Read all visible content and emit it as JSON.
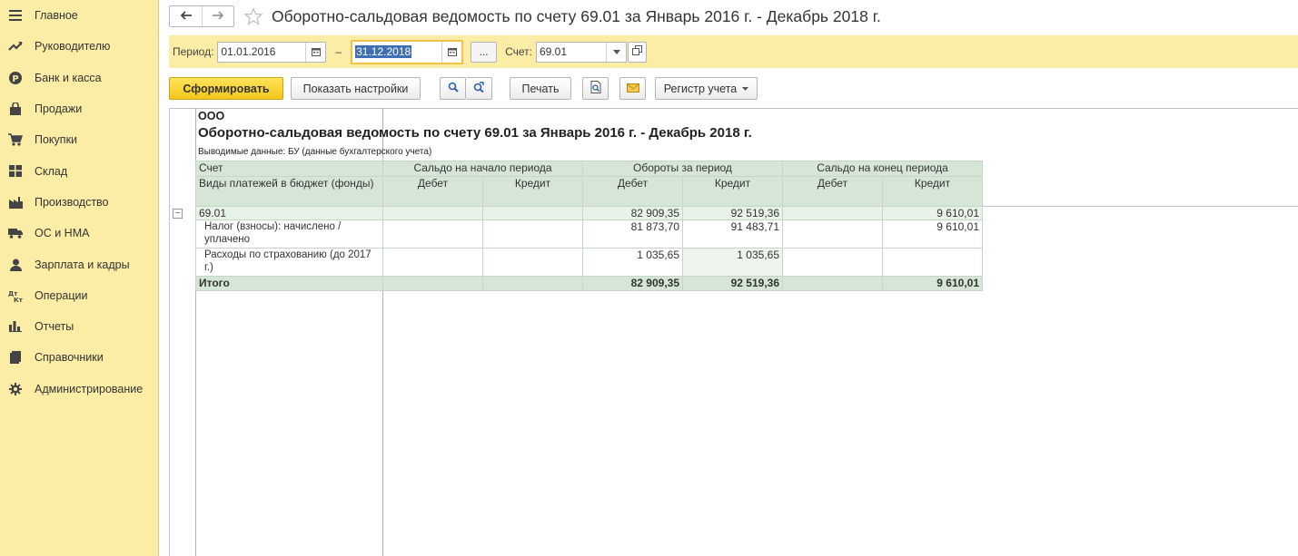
{
  "sidebar": {
    "items": [
      {
        "label": "Главное",
        "icon": "menu-icon"
      },
      {
        "label": "Руководителю",
        "icon": "trend-icon"
      },
      {
        "label": "Банк и касса",
        "icon": "ruble-icon"
      },
      {
        "label": "Продажи",
        "icon": "bag-icon"
      },
      {
        "label": "Покупки",
        "icon": "cart-icon"
      },
      {
        "label": "Склад",
        "icon": "warehouse-icon"
      },
      {
        "label": "Производство",
        "icon": "factory-icon"
      },
      {
        "label": "ОС и НМА",
        "icon": "truck-icon"
      },
      {
        "label": "Зарплата и кадры",
        "icon": "person-icon"
      },
      {
        "label": "Операции",
        "icon": "dt-kt-icon"
      },
      {
        "label": "Отчеты",
        "icon": "bar-chart-icon"
      },
      {
        "label": "Справочники",
        "icon": "book-icon"
      },
      {
        "label": "Администрирование",
        "icon": "gear-icon"
      }
    ]
  },
  "header": {
    "title": "Оборотно-сальдовая ведомость по счету 69.01 за Январь 2016 г. - Декабрь 2018 г."
  },
  "params": {
    "period_label": "Период:",
    "date_from": "01.01.2016",
    "dash": "–",
    "date_to": "31.12.2018",
    "dots": "...",
    "account_label": "Счет:",
    "account": "69.01"
  },
  "toolbar": {
    "generate": "Сформировать",
    "show_settings": "Показать настройки",
    "print": "Печать",
    "registry": "Регистр учета"
  },
  "report": {
    "org": "ООО",
    "title": "Оборотно-сальдовая ведомость по счету 69.01 за Январь 2016 г. - Декабрь 2018 г.",
    "output_data": "Выводимые данные:  БУ (данные бухгалтерского учета)",
    "headers": {
      "account": "Счет",
      "subconto": "Виды платежей в бюджет (фонды)",
      "opening": "Сальдо на начало периода",
      "turnover": "Обороты за период",
      "closing": "Сальдо на конец периода",
      "debit": "Дебет",
      "credit": "Кредит"
    },
    "rows": [
      {
        "name": "69.01",
        "open_dt": "",
        "open_kt": "",
        "turn_dt": "82 909,35",
        "turn_kt": "92 519,36",
        "close_dt": "",
        "close_kt": "9 610,01"
      },
      {
        "name": "Налог (взносы): начислено / уплачено",
        "open_dt": "",
        "open_kt": "",
        "turn_dt": "81 873,70",
        "turn_kt": "91 483,71",
        "close_dt": "",
        "close_kt": "9 610,01"
      },
      {
        "name": "Расходы по страхованию (до 2017 г.)",
        "open_dt": "",
        "open_kt": "",
        "turn_dt": "1 035,65",
        "turn_kt": "1 035,65",
        "close_dt": "",
        "close_kt": ""
      }
    ],
    "total": {
      "name": "Итого",
      "open_dt": "",
      "open_kt": "",
      "turn_dt": "82 909,35",
      "turn_kt": "92 519,36",
      "close_dt": "",
      "close_kt": "9 610,01"
    }
  }
}
